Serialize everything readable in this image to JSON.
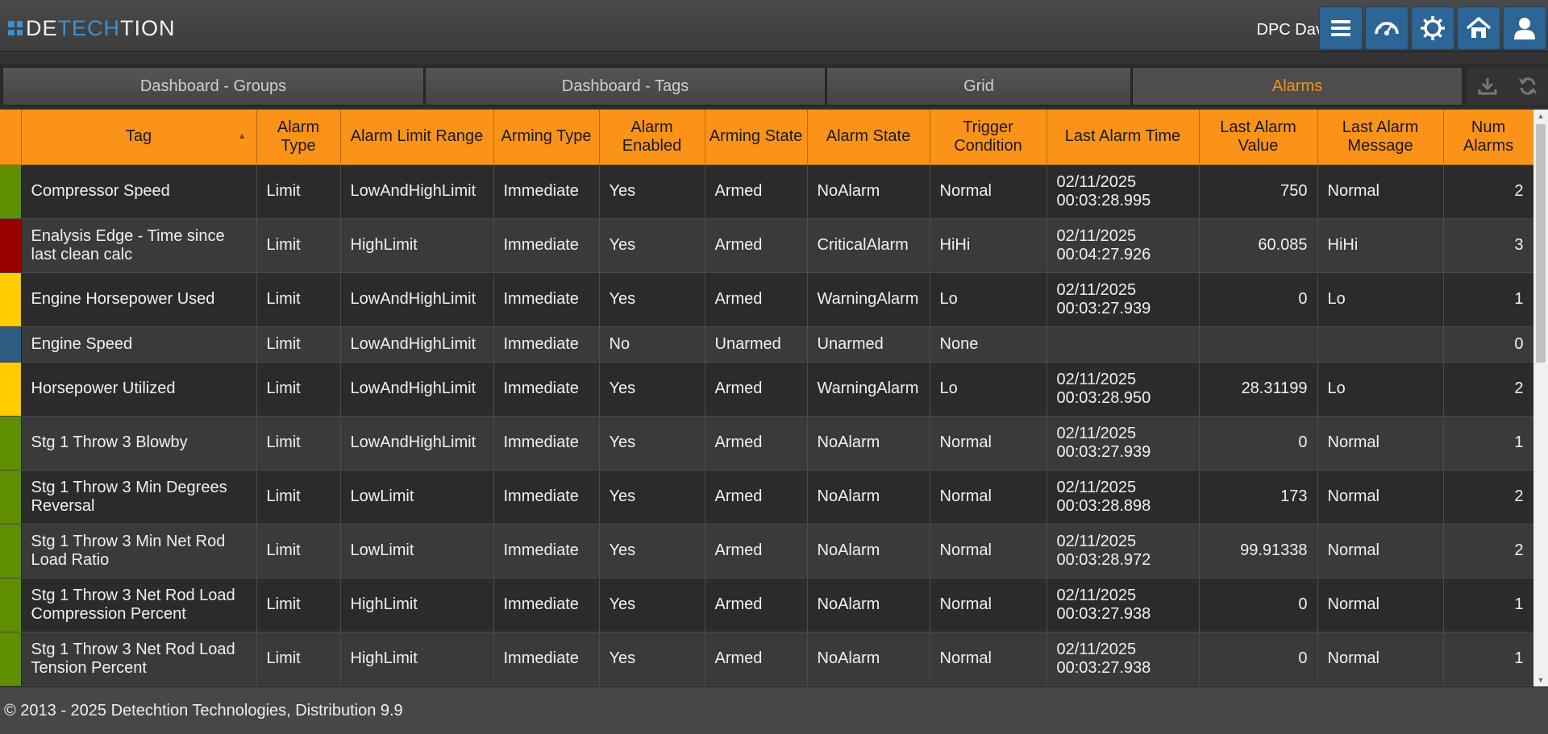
{
  "brand": {
    "logo_part1": "DE",
    "logo_part2": "TECH",
    "logo_part3": "TION"
  },
  "header": {
    "user": "DPC Dave",
    "buttons": [
      {
        "icon": "menu-icon"
      },
      {
        "icon": "dashboard-gauge-icon"
      },
      {
        "icon": "gear-icon"
      },
      {
        "icon": "home-icon"
      },
      {
        "icon": "user-icon"
      }
    ]
  },
  "tabs": [
    {
      "label": "Dashboard - Groups",
      "active": false
    },
    {
      "label": "Dashboard - Tags",
      "active": false
    },
    {
      "label": "Grid",
      "active": false
    },
    {
      "label": "Alarms",
      "active": true
    }
  ],
  "tab_tools": [
    {
      "icon": "download-icon"
    },
    {
      "icon": "refresh-icon"
    }
  ],
  "colors": {
    "header_orange": "#fa9318",
    "active_tab_text": "#f09020",
    "status_normal": "#5f8f00",
    "status_critical": "#990000",
    "status_warning": "#ffcc00",
    "status_unarmed": "#2d5c80"
  },
  "table": {
    "columns": [
      "Tag",
      "Alarm Type",
      "Alarm Limit Range",
      "Arming Type",
      "Alarm Enabled",
      "Arming State",
      "Alarm State",
      "Trigger Condition",
      "Last Alarm Time",
      "Last Alarm Value",
      "Last Alarm Message",
      "Num Alarms"
    ],
    "rows": [
      {
        "status_color": "#5f8f00",
        "tag": "Compressor Speed",
        "alarm_type": "Limit",
        "limit_range": "LowAndHighLimit",
        "arming_type": "Immediate",
        "enabled": "Yes",
        "arming_state": "Armed",
        "alarm_state": "NoAlarm",
        "trigger": "Normal",
        "last_time": "02/11/2025 00:03:28.995",
        "last_value": "750",
        "last_message": "Normal",
        "num": "2"
      },
      {
        "status_color": "#990000",
        "tag": "Enalysis Edge - Time since last clean calc",
        "alarm_type": "Limit",
        "limit_range": "HighLimit",
        "arming_type": "Immediate",
        "enabled": "Yes",
        "arming_state": "Armed",
        "alarm_state": "CriticalAlarm",
        "trigger": "HiHi",
        "last_time": "02/11/2025 00:04:27.926",
        "last_value": "60.085",
        "last_message": "HiHi",
        "num": "3"
      },
      {
        "status_color": "#ffcc00",
        "tag": "Engine Horsepower Used",
        "alarm_type": "Limit",
        "limit_range": "LowAndHighLimit",
        "arming_type": "Immediate",
        "enabled": "Yes",
        "arming_state": "Armed",
        "alarm_state": "WarningAlarm",
        "trigger": "Lo",
        "last_time": "02/11/2025 00:03:27.939",
        "last_value": "0",
        "last_message": "Lo",
        "num": "1"
      },
      {
        "status_color": "#2d5c80",
        "tag": "Engine Speed",
        "alarm_type": "Limit",
        "limit_range": "LowAndHighLimit",
        "arming_type": "Immediate",
        "enabled": "No",
        "arming_state": "Unarmed",
        "alarm_state": "Unarmed",
        "trigger": "None",
        "last_time": "",
        "last_value": "",
        "last_message": "",
        "num": "0"
      },
      {
        "status_color": "#ffcc00",
        "tag": "Horsepower Utilized",
        "alarm_type": "Limit",
        "limit_range": "LowAndHighLimit",
        "arming_type": "Immediate",
        "enabled": "Yes",
        "arming_state": "Armed",
        "alarm_state": "WarningAlarm",
        "trigger": "Lo",
        "last_time": "02/11/2025 00:03:28.950",
        "last_value": "28.31199",
        "last_message": "Lo",
        "num": "2"
      },
      {
        "status_color": "#5f8f00",
        "tag": "Stg 1 Throw 3 Blowby",
        "alarm_type": "Limit",
        "limit_range": "LowAndHighLimit",
        "arming_type": "Immediate",
        "enabled": "Yes",
        "arming_state": "Armed",
        "alarm_state": "NoAlarm",
        "trigger": "Normal",
        "last_time": "02/11/2025 00:03:27.939",
        "last_value": "0",
        "last_message": "Normal",
        "num": "1"
      },
      {
        "status_color": "#5f8f00",
        "tag": "Stg 1 Throw 3 Min Degrees Reversal",
        "alarm_type": "Limit",
        "limit_range": "LowLimit",
        "arming_type": "Immediate",
        "enabled": "Yes",
        "arming_state": "Armed",
        "alarm_state": "NoAlarm",
        "trigger": "Normal",
        "last_time": "02/11/2025 00:03:28.898",
        "last_value": "173",
        "last_message": "Normal",
        "num": "2"
      },
      {
        "status_color": "#5f8f00",
        "tag": "Stg 1 Throw 3 Min Net Rod Load Ratio",
        "alarm_type": "Limit",
        "limit_range": "LowLimit",
        "arming_type": "Immediate",
        "enabled": "Yes",
        "arming_state": "Armed",
        "alarm_state": "NoAlarm",
        "trigger": "Normal",
        "last_time": "02/11/2025 00:03:28.972",
        "last_value": "99.91338",
        "last_message": "Normal",
        "num": "2"
      },
      {
        "status_color": "#5f8f00",
        "tag": "Stg 1 Throw 3 Net Rod Load Compression Percent",
        "alarm_type": "Limit",
        "limit_range": "HighLimit",
        "arming_type": "Immediate",
        "enabled": "Yes",
        "arming_state": "Armed",
        "alarm_state": "NoAlarm",
        "trigger": "Normal",
        "last_time": "02/11/2025 00:03:27.938",
        "last_value": "0",
        "last_message": "Normal",
        "num": "1"
      },
      {
        "status_color": "#5f8f00",
        "tag": "Stg 1 Throw 3 Net Rod Load Tension Percent",
        "alarm_type": "Limit",
        "limit_range": "HighLimit",
        "arming_type": "Immediate",
        "enabled": "Yes",
        "arming_state": "Armed",
        "alarm_state": "NoAlarm",
        "trigger": "Normal",
        "last_time": "02/11/2025 00:03:27.938",
        "last_value": "0",
        "last_message": "Normal",
        "num": "1"
      }
    ]
  },
  "footer": {
    "text": "© 2013 - 2025 Detechtion Technologies, Distribution 9.9"
  }
}
